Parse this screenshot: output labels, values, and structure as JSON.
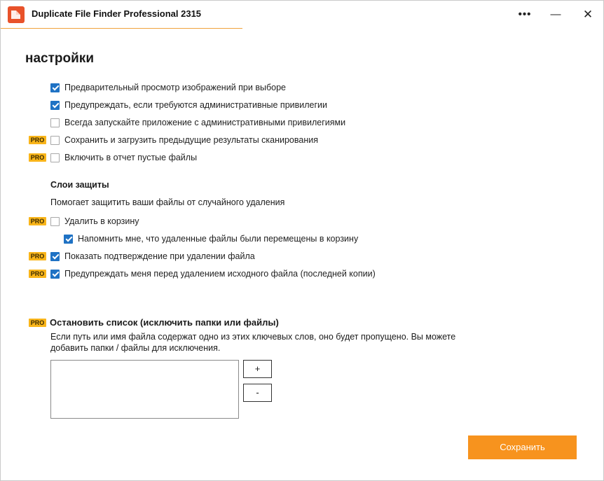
{
  "window": {
    "title": "Duplicate File Finder Professional 2315",
    "more_label": "•••",
    "minimize_label": "—",
    "close_label": "✕"
  },
  "page": {
    "title": "настройки"
  },
  "pro_badge": "PRO",
  "general_options": [
    {
      "label": "Предварительный просмотр изображений при выборе",
      "checked": true,
      "pro": false
    },
    {
      "label": "Предупреждать, если требуются административные привилегии",
      "checked": true,
      "pro": false
    },
    {
      "label": "Всегда запускайте приложение с административными привилегиями",
      "checked": false,
      "pro": false
    },
    {
      "label": "Сохранить и загрузить предыдущие результаты сканирования",
      "checked": false,
      "pro": true
    },
    {
      "label": "Включить в отчет пустые файлы",
      "checked": false,
      "pro": true
    }
  ],
  "protection": {
    "title": "Слои защиты",
    "description": "Помогает защитить ваши файлы от случайного удаления",
    "options": [
      {
        "label": "Удалить в корзину",
        "checked": false,
        "pro": true
      },
      {
        "label": "Напомнить мне, что удаленные файлы были перемещены в корзину",
        "checked": true,
        "pro": false
      },
      {
        "label": "Показать подтверждение при удалении файла",
        "checked": true,
        "pro": true
      },
      {
        "label": "Предупреждать меня перед удалением исходного файла (последней копии)",
        "checked": true,
        "pro": true
      }
    ]
  },
  "stop_list": {
    "title": "Остановить список (исключить папки или файлы)",
    "description": "Если путь или имя файла содержат одно из этих ключевых слов, оно будет пропущено. Вы можете добавить папки / файлы для исключения.",
    "add_label": "+",
    "remove_label": "-"
  },
  "save_label": "Сохранить",
  "colors": {
    "accent": "#f7931e",
    "checkbox": "#1f72c4",
    "pro_badge": "#f9b51a",
    "logo": "#e8522a"
  }
}
